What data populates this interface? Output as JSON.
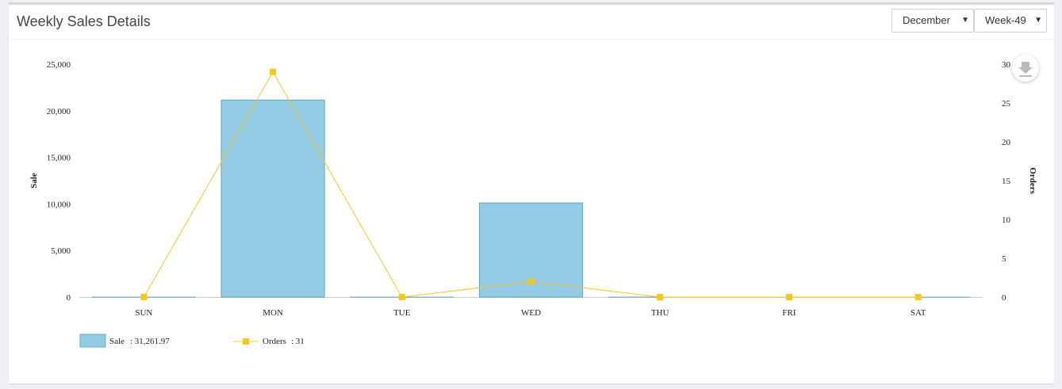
{
  "header": {
    "title": "Weekly Sales Details",
    "month_select": "December",
    "week_select": "Week-49"
  },
  "icons": {
    "download": "download-icon",
    "dropdown": "caret-down-icon"
  },
  "chart_data": {
    "type": "bar",
    "categories": [
      "SUN",
      "MON",
      "TUE",
      "WED",
      "THU",
      "FRI",
      "SAT"
    ],
    "series": [
      {
        "name": "Sale",
        "type": "bar",
        "axis": "left",
        "color": "#93cbe4",
        "values": [
          0,
          21150,
          0,
          10110,
          0,
          0,
          0
        ]
      },
      {
        "name": "Orders",
        "type": "line",
        "axis": "right",
        "color": "#f5c91b",
        "values": [
          0,
          29,
          0,
          2,
          0,
          0,
          0
        ]
      }
    ],
    "ylabel": "Sale",
    "y2label": "Orders",
    "ylim": [
      0,
      25000
    ],
    "y2lim": [
      0,
      30
    ],
    "yticks": [
      "0",
      "5,000",
      "10,000",
      "15,000",
      "20,000",
      "25,000"
    ],
    "y2ticks": [
      "0",
      "5",
      "10",
      "15",
      "20",
      "25",
      "30"
    ],
    "legend": [
      {
        "label": "Sale",
        "summary": ": 31,261.97"
      },
      {
        "label": "Orders",
        "summary": ": 31"
      }
    ],
    "legend_position": "bottom-left",
    "grid": false
  }
}
